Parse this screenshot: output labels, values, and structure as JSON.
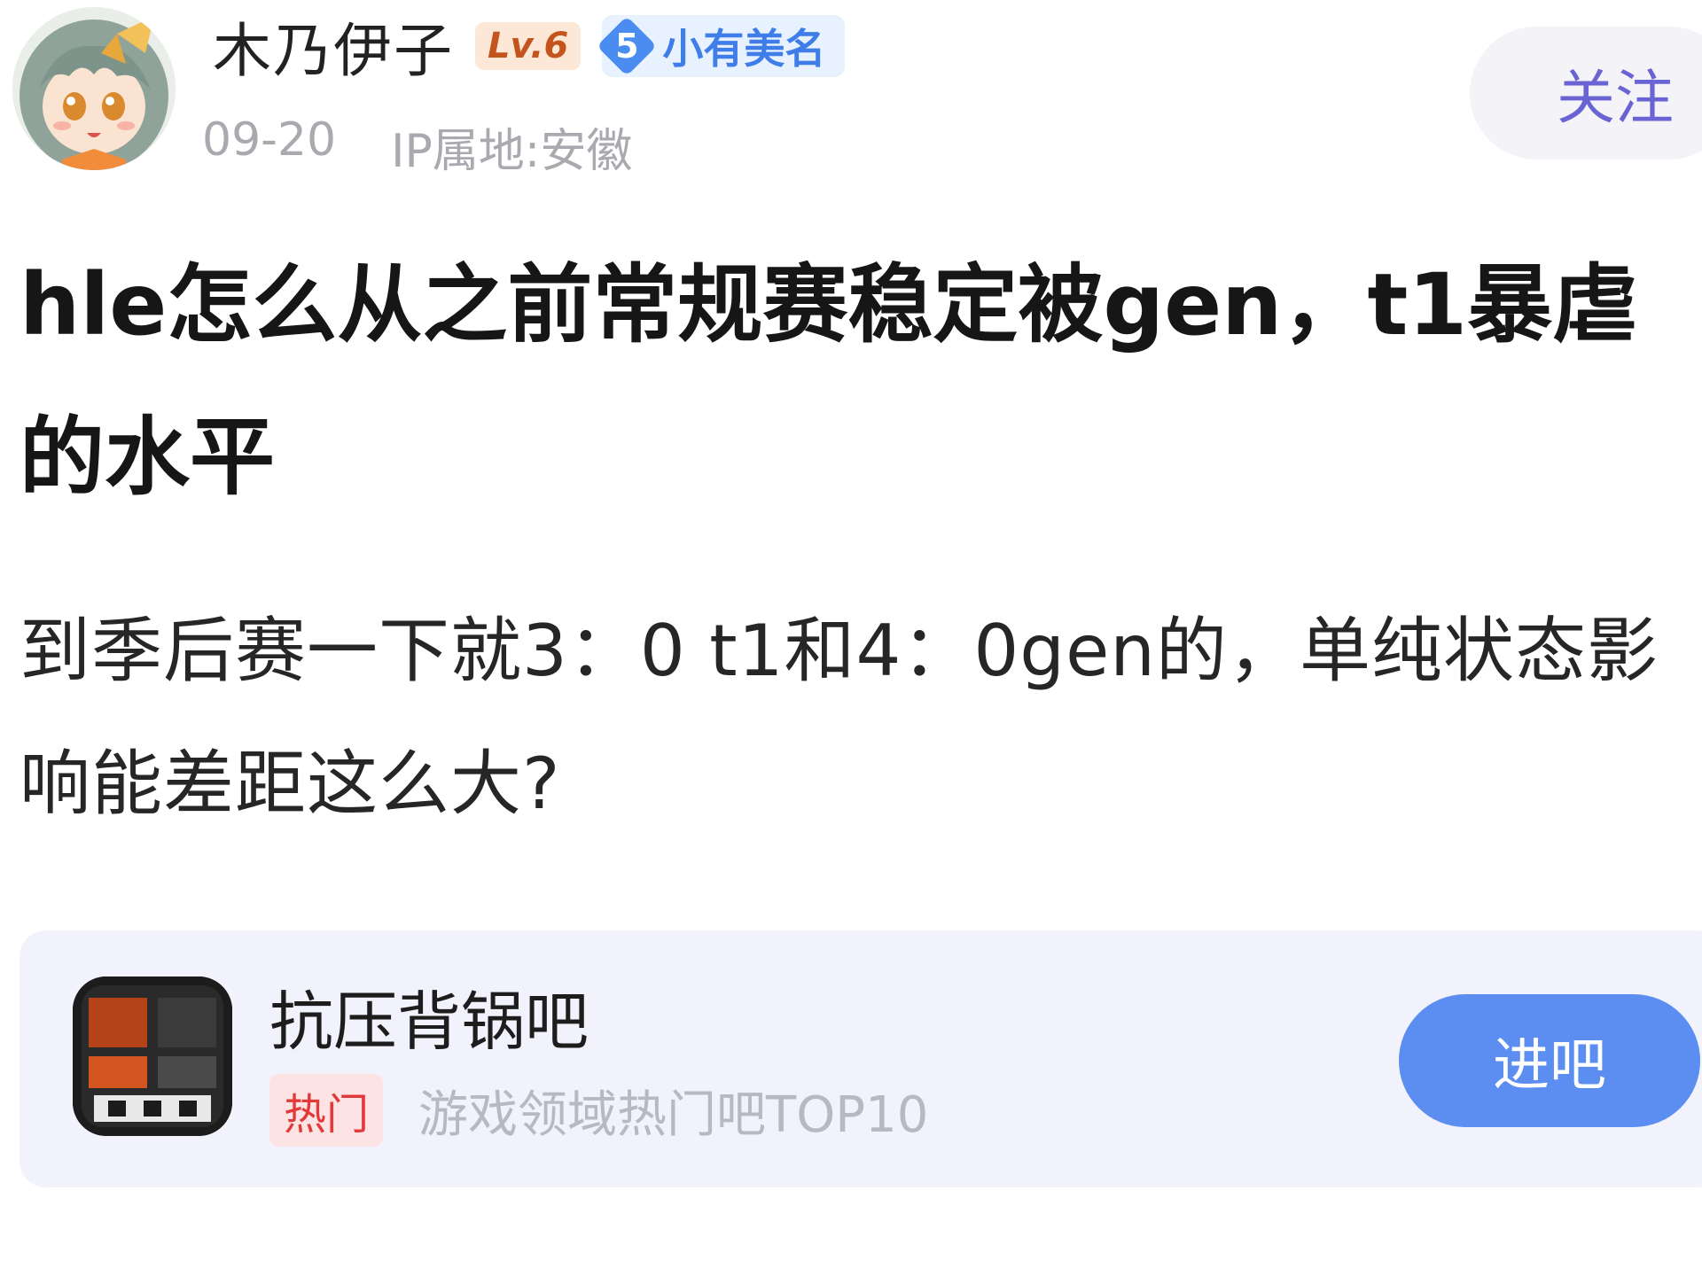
{
  "author": {
    "name": "木乃伊子",
    "level": "Lv.6",
    "honor_level": "5",
    "honor_title": "小有美名",
    "post_date": "09-20",
    "ip_location": "IP属地:安徽",
    "follow_label": "关注"
  },
  "post": {
    "title": "hle怎么从之前常规赛稳定被gen，t1暴虐的水平",
    "body": "到季后赛一下就3：0 t1和4：0gen的，单纯状态影响能差距这么大?"
  },
  "forum_card": {
    "icon_text": "抗压背锅吧",
    "name": "抗压背锅吧",
    "tag": "热门",
    "rank_text": "游戏领域热门吧TOP10",
    "enter_label": "进吧"
  }
}
